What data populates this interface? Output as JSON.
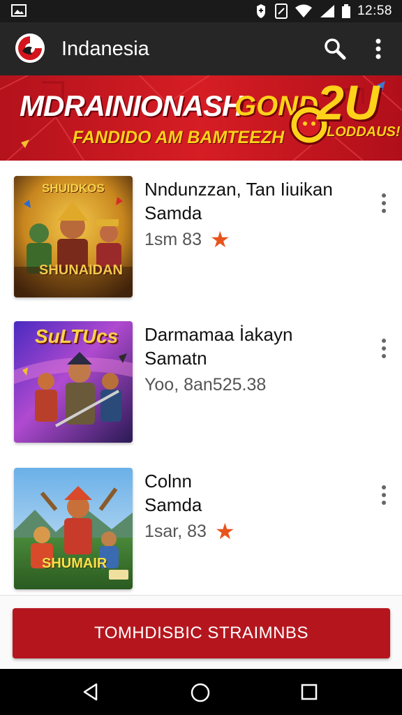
{
  "status_bar": {
    "time": "12:58",
    "icons": [
      "gallery-icon",
      "data-saver-icon",
      "nfc-icon",
      "wifi-icon",
      "signal-icon",
      "battery-icon"
    ]
  },
  "app_bar": {
    "title": "Indanesia",
    "logo_icon": "app-logo-icon",
    "search_icon": "search-icon",
    "more_icon": "more-vert-icon"
  },
  "banner": {
    "title": "MDRAINIONASH",
    "gold_text": "GOND",
    "gold_suffix": "2U",
    "subtitle": "FANDIDO AM BAMTEEZH",
    "tag": "LODDAUS!",
    "colors": {
      "background": "#d61d24",
      "text": "#ffffff",
      "accent": "#ffd21a"
    }
  },
  "games": [
    {
      "title": "Nndunzzan, Tan Iiuikan",
      "subtitle": "Samda",
      "meta": "1sm 83",
      "has_star": true,
      "thumb_top_text": "SHUIDKOS",
      "thumb_bottom_text": "SHUNAIDAN",
      "thumb_colors": [
        "#d09a2a",
        "#5a3612"
      ]
    },
    {
      "title": "Darmamaa İakayn",
      "subtitle": "Samatn",
      "meta": "Yoo, 8an525.38",
      "has_star": false,
      "thumb_top_text": "SuLTUcs",
      "thumb_bottom_text": "",
      "thumb_colors": [
        "#8a3fc0",
        "#2a1a55"
      ]
    },
    {
      "title": "Colnn",
      "subtitle": "Samda",
      "meta": "1sar, 83",
      "has_star": true,
      "thumb_top_text": "",
      "thumb_bottom_text": "SHUMAIR",
      "thumb_colors": [
        "#4a90d0",
        "#3a7a2a"
      ]
    }
  ],
  "cta": {
    "label": "TOMHDISBIC STRAIMNBS",
    "color": "#b5161e"
  },
  "nav_bar": {
    "icons": [
      "back-icon",
      "home-icon",
      "recents-icon"
    ]
  },
  "colors": {
    "accent": "#e8531c",
    "app_bar": "#262626",
    "status_bar": "#1a1a1a"
  }
}
